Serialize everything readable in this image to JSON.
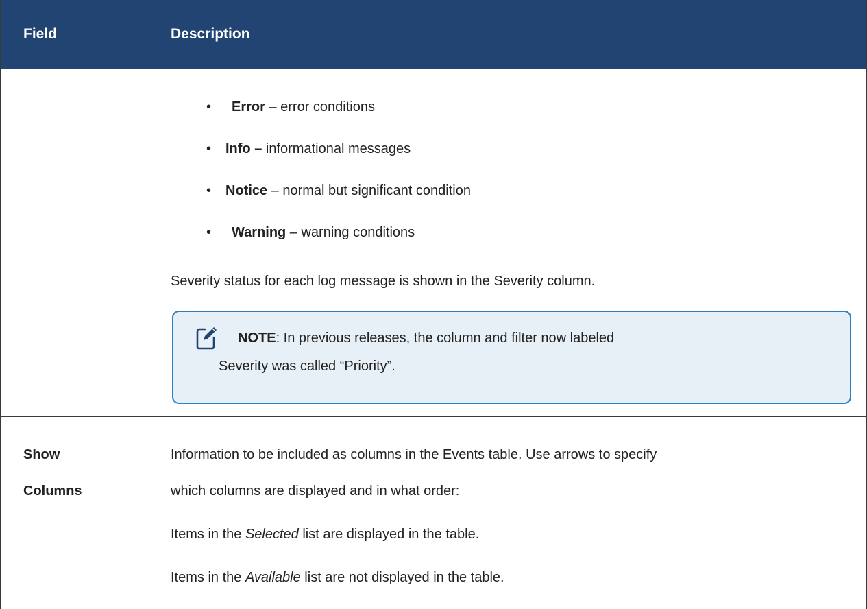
{
  "table": {
    "header": {
      "field": "Field",
      "description": "Description"
    },
    "severity_row": {
      "bullets": [
        {
          "term": "Error",
          "text": " – error conditions"
        },
        {
          "term": "Info –",
          "text": " informational messages"
        },
        {
          "term": "Notice",
          "text": " – normal but significant condition"
        },
        {
          "term": "Warning",
          "text": " – warning conditions"
        }
      ],
      "status_text": "Severity status for each log message is shown in the Severity column.",
      "note": {
        "icon": "note-edit-icon",
        "label": "NOTE",
        "line1": ":  In previous releases, the column and filter now labeled",
        "line2": "Severity was called “Priority”."
      }
    },
    "show_columns_row": {
      "field_line1": "Show",
      "field_line2": "Columns",
      "line1": "Information to be included as columns in the Events table. Use arrows to specify",
      "line2": "which columns are displayed and in what order:",
      "selected_pre": "Items in the ",
      "selected_em": "Selected",
      "selected_post": " list are displayed in the table.",
      "available_pre": "Items in the ",
      "available_em": "Available",
      "available_post": " list are not displayed in the table."
    }
  },
  "colors": {
    "header_bg": "#214473",
    "note_border": "#2e7fc0",
    "note_bg": "#e8f0f7"
  }
}
